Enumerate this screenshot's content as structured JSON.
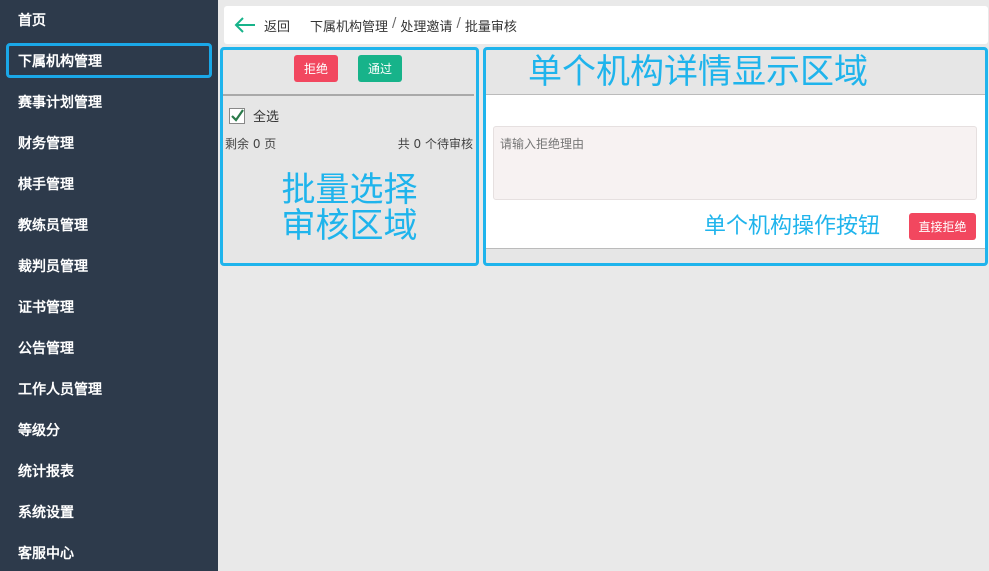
{
  "sidebar": {
    "items": [
      {
        "label": "首页",
        "active": false
      },
      {
        "label": "下属机构管理",
        "active": true
      },
      {
        "label": "赛事计划管理",
        "active": false
      },
      {
        "label": "财务管理",
        "active": false
      },
      {
        "label": "棋手管理",
        "active": false
      },
      {
        "label": "教练员管理",
        "active": false
      },
      {
        "label": "裁判员管理",
        "active": false
      },
      {
        "label": "证书管理",
        "active": false
      },
      {
        "label": "公告管理",
        "active": false
      },
      {
        "label": "工作人员管理",
        "active": false
      },
      {
        "label": "等级分",
        "active": false
      },
      {
        "label": "统计报表",
        "active": false
      },
      {
        "label": "系统设置",
        "active": false
      },
      {
        "label": "客服中心",
        "active": false
      }
    ]
  },
  "header": {
    "back_label": "返回",
    "breadcrumb": [
      "下属机构管理",
      "处理邀请",
      "批量审核"
    ],
    "separator": "/"
  },
  "batch_panel": {
    "reject_label": "拒绝",
    "pass_label": "通过",
    "select_all_label": "全选",
    "select_all_checked": true,
    "remaining_text": "剩余 0 页",
    "pending_text": "共 0 个待审核",
    "annotation_line1": "批量选择",
    "annotation_line2": "审核区域"
  },
  "detail_panel": {
    "annotation_title": "单个机构详情显示区域",
    "reason_placeholder": "请输入拒绝理由",
    "annotation_buttons": "单个机构操作按钮",
    "direct_reject_label": "直接拒绝"
  },
  "colors": {
    "sidebar_bg": "#2d3a4b",
    "annotation": "#1fb4ec",
    "reject": "#f2475f",
    "pass": "#17b38a",
    "back_arrow": "#17b38a"
  }
}
